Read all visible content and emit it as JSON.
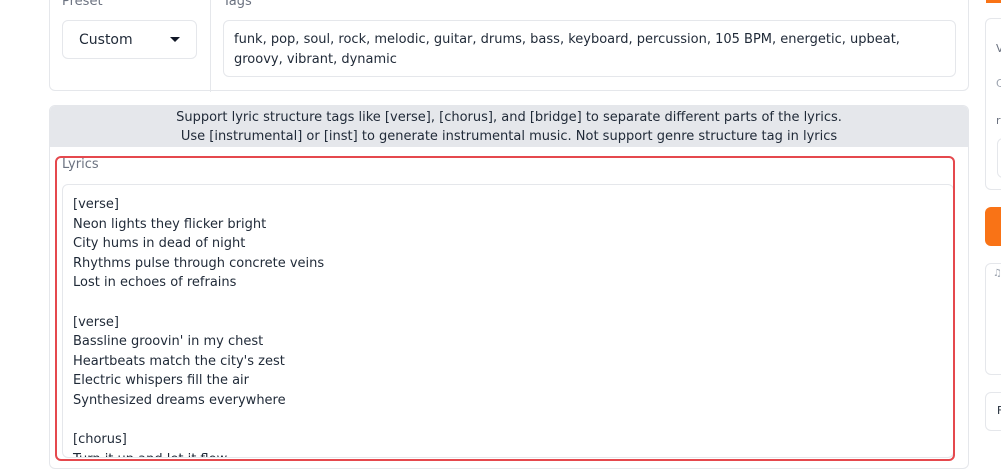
{
  "preset": {
    "label": "Preset",
    "value": "Custom"
  },
  "tags": {
    "label": "Tags",
    "value": "funk, pop, soul, rock, melodic, guitar, drums, bass, keyboard, percussion, 105 BPM, energetic, upbeat, groovy, vibrant, dynamic"
  },
  "info": {
    "line1": "Support lyric structure tags like [verse], [chorus], and [bridge] to separate different parts of the lyrics.",
    "line2": "Use [instrumental] or [inst] to generate instrumental music. Not support genre structure tag in lyrics"
  },
  "lyrics": {
    "label": "Lyrics",
    "lines": [
      "[verse]",
      "Neon lights they flicker bright",
      "City hums in dead of night",
      "Rhythms pulse through concrete veins",
      "Lost in echoes of refrains",
      "",
      "[verse]",
      "Bassline groovin' in my chest",
      "Heartbeats match the city's zest",
      "Electric whispers fill the air",
      "Synthesized dreams everywhere",
      "",
      "[chorus]",
      "Turn it up and let it flow"
    ]
  },
  "sidebar": {
    "letter_v": "V",
    "letter_c": "C",
    "letter_r": "r",
    "letter_f": "F"
  },
  "colors": {
    "accent": "#f97316",
    "highlight": "#e5484d",
    "info_band": "#e5e7eb"
  }
}
